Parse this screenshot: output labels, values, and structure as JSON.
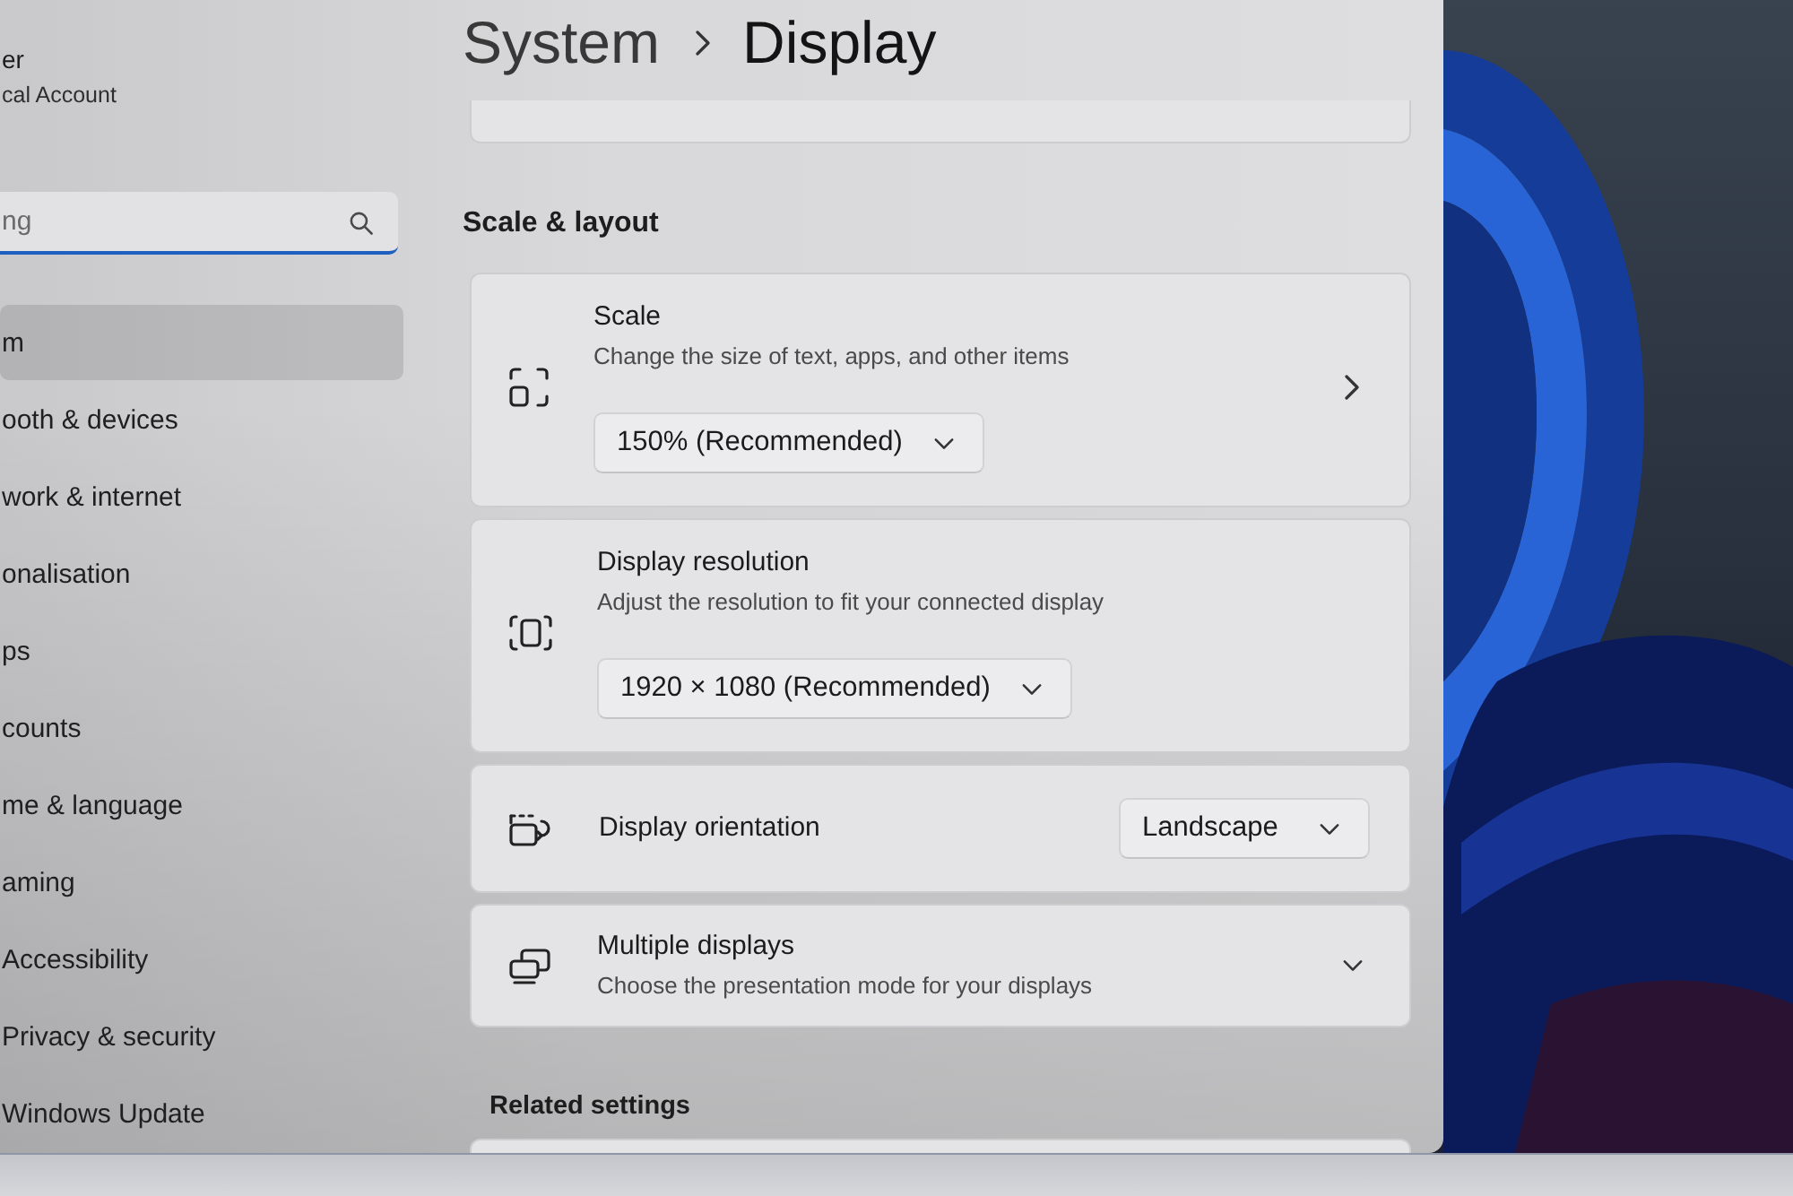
{
  "account": {
    "name": "er",
    "type": "cal Account"
  },
  "search": {
    "placeholder": "ng"
  },
  "sidebar": {
    "items": [
      {
        "label": "m",
        "selected": true
      },
      {
        "label": "ooth & devices",
        "selected": false
      },
      {
        "label": "work & internet",
        "selected": false
      },
      {
        "label": "onalisation",
        "selected": false
      },
      {
        "label": "ps",
        "selected": false
      },
      {
        "label": "counts",
        "selected": false
      },
      {
        "label": "me & language",
        "selected": false
      },
      {
        "label": "aming",
        "selected": false
      },
      {
        "label": "Accessibility",
        "selected": false
      },
      {
        "label": "Privacy & security",
        "selected": false
      },
      {
        "label": "Windows Update",
        "selected": false
      }
    ]
  },
  "header": {
    "breadcrumb": [
      "System",
      "Display"
    ]
  },
  "scale_layout": {
    "heading": "Scale & layout",
    "cards": [
      {
        "kind": "stacked",
        "title": "Scale",
        "description": "Change the size of text, apps, and other items",
        "value": "150% (Recommended)",
        "link": true
      },
      {
        "kind": "stacked",
        "title": "Display resolution",
        "description": "Adjust the resolution to fit your connected display",
        "value": "1920 × 1080 (Recommended)",
        "link": false
      },
      {
        "kind": "inline",
        "title": "Display orientation",
        "value": "Landscape"
      },
      {
        "kind": "expander",
        "title": "Multiple displays",
        "description": "Choose the presentation mode for your displays",
        "expanded": false
      }
    ]
  },
  "related_settings": {
    "heading": "Related settings"
  }
}
